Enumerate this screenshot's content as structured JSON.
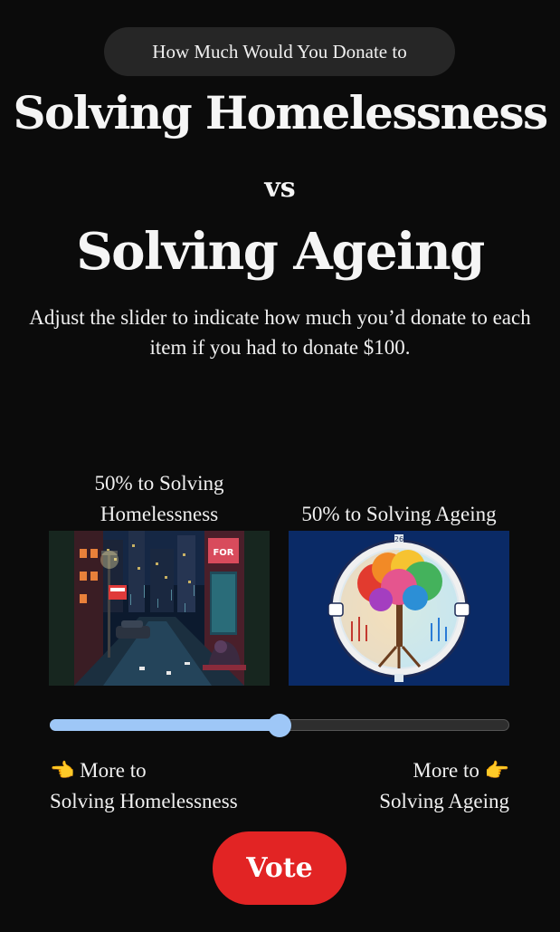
{
  "header": {
    "pill_text": "How Much Would You Donate to",
    "title_left": "Solving Homelessness",
    "vs_text": "vs",
    "title_right": "Solving Ageing",
    "instructions": "Adjust the slider to indicate how much you’d donate to each item if you had to donate $100."
  },
  "options": {
    "left": {
      "percent_line1": "50% to Solving",
      "percent_line2": "Homelessness",
      "image_icon": "homeless-city-night-illustration"
    },
    "right": {
      "percent_label": "50% to Solving Ageing",
      "image_icon": "tree-of-life-clock-illustration"
    }
  },
  "slider": {
    "value_fraction": 0.5,
    "fill_color": "#9ec7f7"
  },
  "labels": {
    "left_line1": "More to",
    "left_line2": "Solving Homelessness",
    "right_line1": "More to",
    "right_line2": "Solving Ageing",
    "left_hand_icon": "👈",
    "right_hand_icon": "👉"
  },
  "vote_button": {
    "label": "Vote",
    "color": "#e22424"
  }
}
